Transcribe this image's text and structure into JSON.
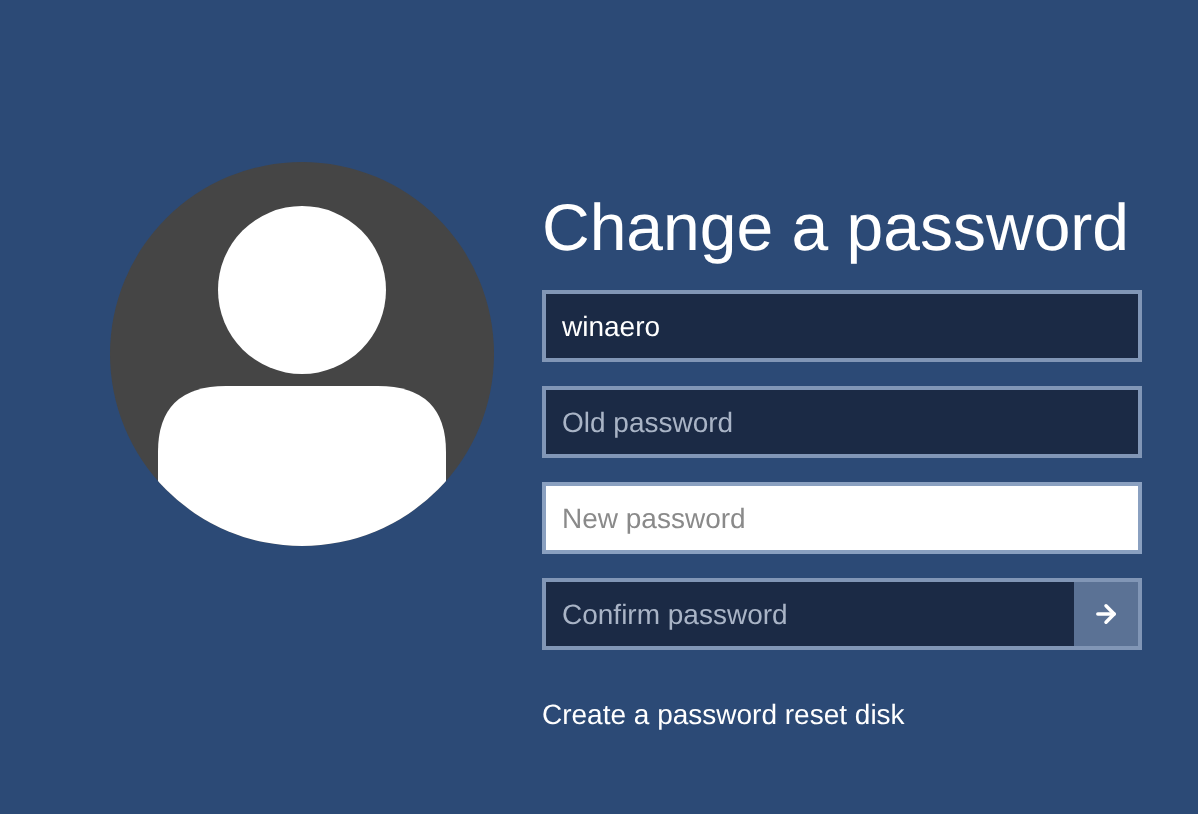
{
  "title": "Change a password",
  "fields": [
    {
      "value": "winaero",
      "focused": false,
      "submit": false
    },
    {
      "placeholder": "Old password",
      "focused": false,
      "submit": false
    },
    {
      "placeholder": "New password",
      "focused": true,
      "submit": false
    },
    {
      "placeholder": "Confirm password",
      "focused": false,
      "submit": true
    }
  ],
  "link": "Create a password reset disk"
}
